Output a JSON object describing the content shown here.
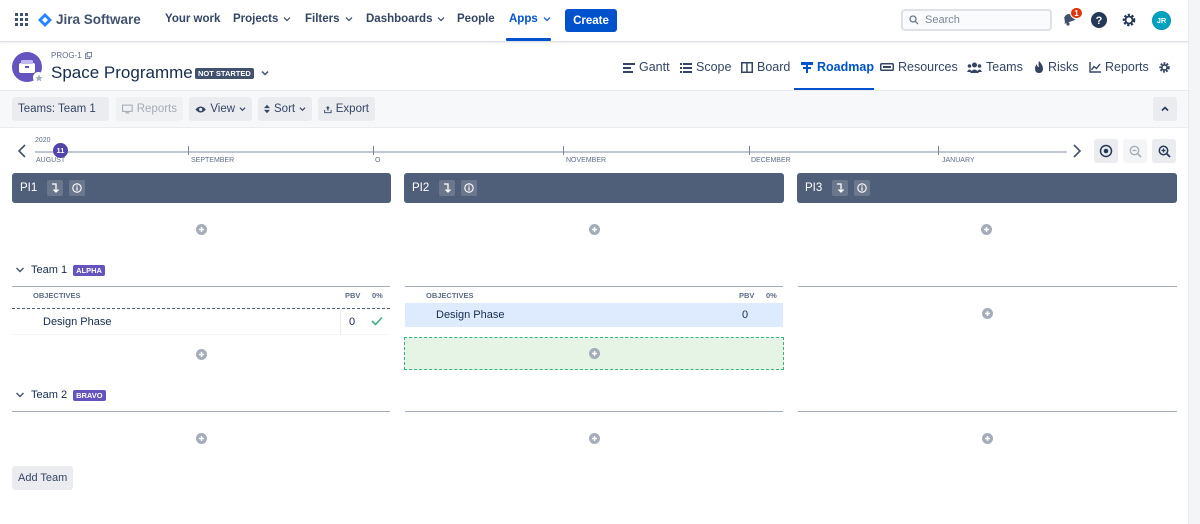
{
  "topnav": {
    "product_name": "Jira Software",
    "items": [
      {
        "label": "Your work",
        "dropdown": false
      },
      {
        "label": "Projects",
        "dropdown": true
      },
      {
        "label": "Filters",
        "dropdown": true
      },
      {
        "label": "Dashboards",
        "dropdown": true
      },
      {
        "label": "People",
        "dropdown": false
      },
      {
        "label": "Apps",
        "dropdown": true,
        "active": true
      }
    ],
    "create_label": "Create",
    "search_placeholder": "Search",
    "notification_count": "1",
    "avatar_initials": "JR"
  },
  "project": {
    "key": "PROG-1",
    "name": "Space Programme",
    "status": "NOT STARTED"
  },
  "project_tabs": [
    {
      "label": "Gantt",
      "icon": "gantt-icon"
    },
    {
      "label": "Scope",
      "icon": "scope-icon"
    },
    {
      "label": "Board",
      "icon": "board-icon"
    },
    {
      "label": "Roadmap",
      "icon": "roadmap-icon",
      "active": true
    },
    {
      "label": "Resources",
      "icon": "resources-icon"
    },
    {
      "label": "Teams",
      "icon": "teams-icon"
    },
    {
      "label": "Risks",
      "icon": "risks-icon"
    },
    {
      "label": "Reports",
      "icon": "reports-icon"
    }
  ],
  "toolbar": {
    "teams_label": "Teams: Team 1",
    "reports_label": "Reports",
    "view_label": "View",
    "sort_label": "Sort",
    "export_label": "Export"
  },
  "timeline": {
    "year": "2020",
    "current_marker": "11",
    "months": [
      "AUGUST",
      "SEPTEMBER",
      "O",
      "NOVEMBER",
      "DECEMBER",
      "JANUARY"
    ]
  },
  "increments": [
    {
      "name": "PI1"
    },
    {
      "name": "PI2"
    },
    {
      "name": "PI3"
    }
  ],
  "teams": [
    {
      "name": "Team 1",
      "badge": "ALPHA",
      "objectives_header": "OBJECTIVES",
      "pbv_header": "PBV",
      "pct_header": "0%",
      "pi1_objective": {
        "name": "Design Phase",
        "pbv": "0"
      },
      "pi2_objective": {
        "name": "Design Phase",
        "pbv": "0"
      }
    },
    {
      "name": "Team 2",
      "badge": "BRAVO"
    }
  ],
  "add_team_label": "Add Team",
  "colors": {
    "brand_blue": "#0052CC",
    "pi_header": "#505F79",
    "team_badge": "#6554C0",
    "selected_row": "#DEEBFF",
    "drop_zone": "#E6F4E6"
  }
}
